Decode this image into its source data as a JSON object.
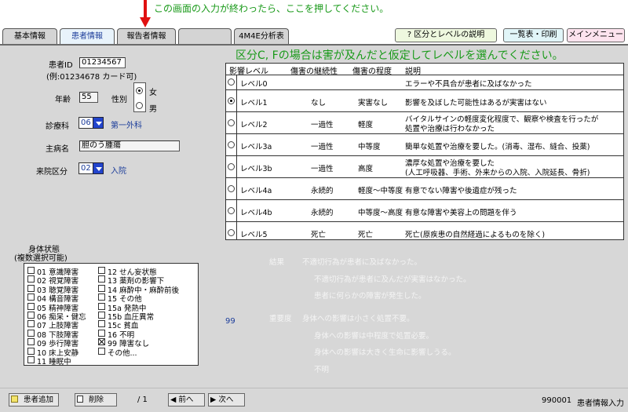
{
  "hint": "この画面の入力が終わったら、ここを押してください。",
  "tabs": [
    {
      "label": "基本情報"
    },
    {
      "label": "患者情報"
    },
    {
      "label": "報告者情報"
    },
    {
      "label": ""
    },
    {
      "label": "4M4E分析表"
    }
  ],
  "toolbar": {
    "help_label": "? 区分とレベルの説明",
    "list_label": "一覧表・印刷",
    "menu_label": "メインメニュー"
  },
  "patient": {
    "id_label": "患者ID",
    "id_value": "01234567",
    "id_example": "(例:01234678 カード可)",
    "age_label": "年齢",
    "age_value": "55",
    "sex_label": "性別",
    "sex_female": "女",
    "sex_male": "男",
    "dept_label": "診療科",
    "dept_code": "06",
    "dept_name": "第一外科",
    "disease_label": "主病名",
    "disease_value": "胆のう腫瘍",
    "visit_label": "来院区分",
    "visit_code": "02",
    "visit_name": "入院"
  },
  "level_section": {
    "title": "区分C, Fの場合は害が及んだと仮定してレベルを選んでください。",
    "headers": [
      "影響レベル",
      "傷害の継続性",
      "傷害の程度",
      "説明"
    ],
    "rows": [
      {
        "level": "レベル0",
        "continuity": "",
        "degree": "",
        "desc": "エラーや不具合が患者に及ばなかった",
        "desc2": ""
      },
      {
        "level": "レベル1",
        "continuity": "なし",
        "degree": "実害なし",
        "desc": "影響を及ぼした可能性はあるが実害はない",
        "desc2": ""
      },
      {
        "level": "レベル2",
        "continuity": "一過性",
        "degree": "軽度",
        "desc": "バイタルサインの軽度変化程度で、観察や検査を行ったが",
        "desc2": "処置や治療は行わなかった"
      },
      {
        "level": "レベル3a",
        "continuity": "一過性",
        "degree": "中等度",
        "desc": "簡単な処置や治療を要した。(消毒、湿布、縫合、投薬)",
        "desc2": ""
      },
      {
        "level": "レベル3b",
        "continuity": "一過性",
        "degree": "高度",
        "desc": "濃厚な処置や治療を要した",
        "desc2": "(人工呼吸器、手術、外来からの入院、入院延長、骨折)"
      },
      {
        "level": "レベル4a",
        "continuity": "永続的",
        "degree": "軽度～中等度",
        "desc": "有意でない障害や後遺症が残った",
        "desc2": ""
      },
      {
        "level": "レベル4b",
        "continuity": "永続的",
        "degree": "中等度～高度",
        "desc": "有意な障害や美容上の問題を伴う",
        "desc2": ""
      },
      {
        "level": "レベル5",
        "continuity": "死亡",
        "degree": "死亡",
        "desc": "死亡(原疾患の自然経過によるものを除く)",
        "desc2": ""
      }
    ]
  },
  "body_state": {
    "title1": "身体状態",
    "title2": "(複数選択可能)",
    "left": [
      "01 意識障害",
      "02 視覚障害",
      "03 聴覚障害",
      "04 構音障害",
      "05 精神障害",
      "06 痴呆・健忘",
      "07 上肢障害",
      "08 下肢障害",
      "09 歩行障害",
      "10 床上安静",
      "11 睡眠中"
    ],
    "right": [
      "12 せん妄状態",
      "13 薬剤の影響下",
      "14 麻酔中・麻酔前後",
      "15 その他",
      "15a 発熱中",
      "15b 血圧異常",
      "15c 貧血",
      "16 不明",
      "99 障害なし",
      "その他..."
    ],
    "code": "99"
  },
  "faded": {
    "result_label": "結果",
    "result_opt1": "不適切行為が患者に及ばなかった。",
    "result_opt2": "不適切行為が患者に及んだが実害はなかった。",
    "result_opt3": "患者に何らかの障害が発生した。",
    "severity_label": "重要度",
    "severity_opt1": "身体への影響は小さく処置不要。",
    "severity_opt2": "身体への影響は中程度で処置必要。",
    "severity_opt3": "身体への影響は大きく生命に影響しうる。",
    "severity_opt4": "不明"
  },
  "footer": {
    "add_label": "患者追加",
    "delete_label": "削除",
    "page": "/ 1",
    "prev_label": "前へ",
    "next_label": "次へ",
    "user_id": "990001",
    "screen_name": "患者情報入力"
  },
  "colors": {
    "hint_green": "#1a9a1a",
    "panel_gray": "#d7d7d7",
    "combo_blue": "#2244cc",
    "help_btn_bg": "#eef8df",
    "list_btn_bg": "#e1f5f8",
    "menu_btn_bg": "#fde3ee"
  }
}
